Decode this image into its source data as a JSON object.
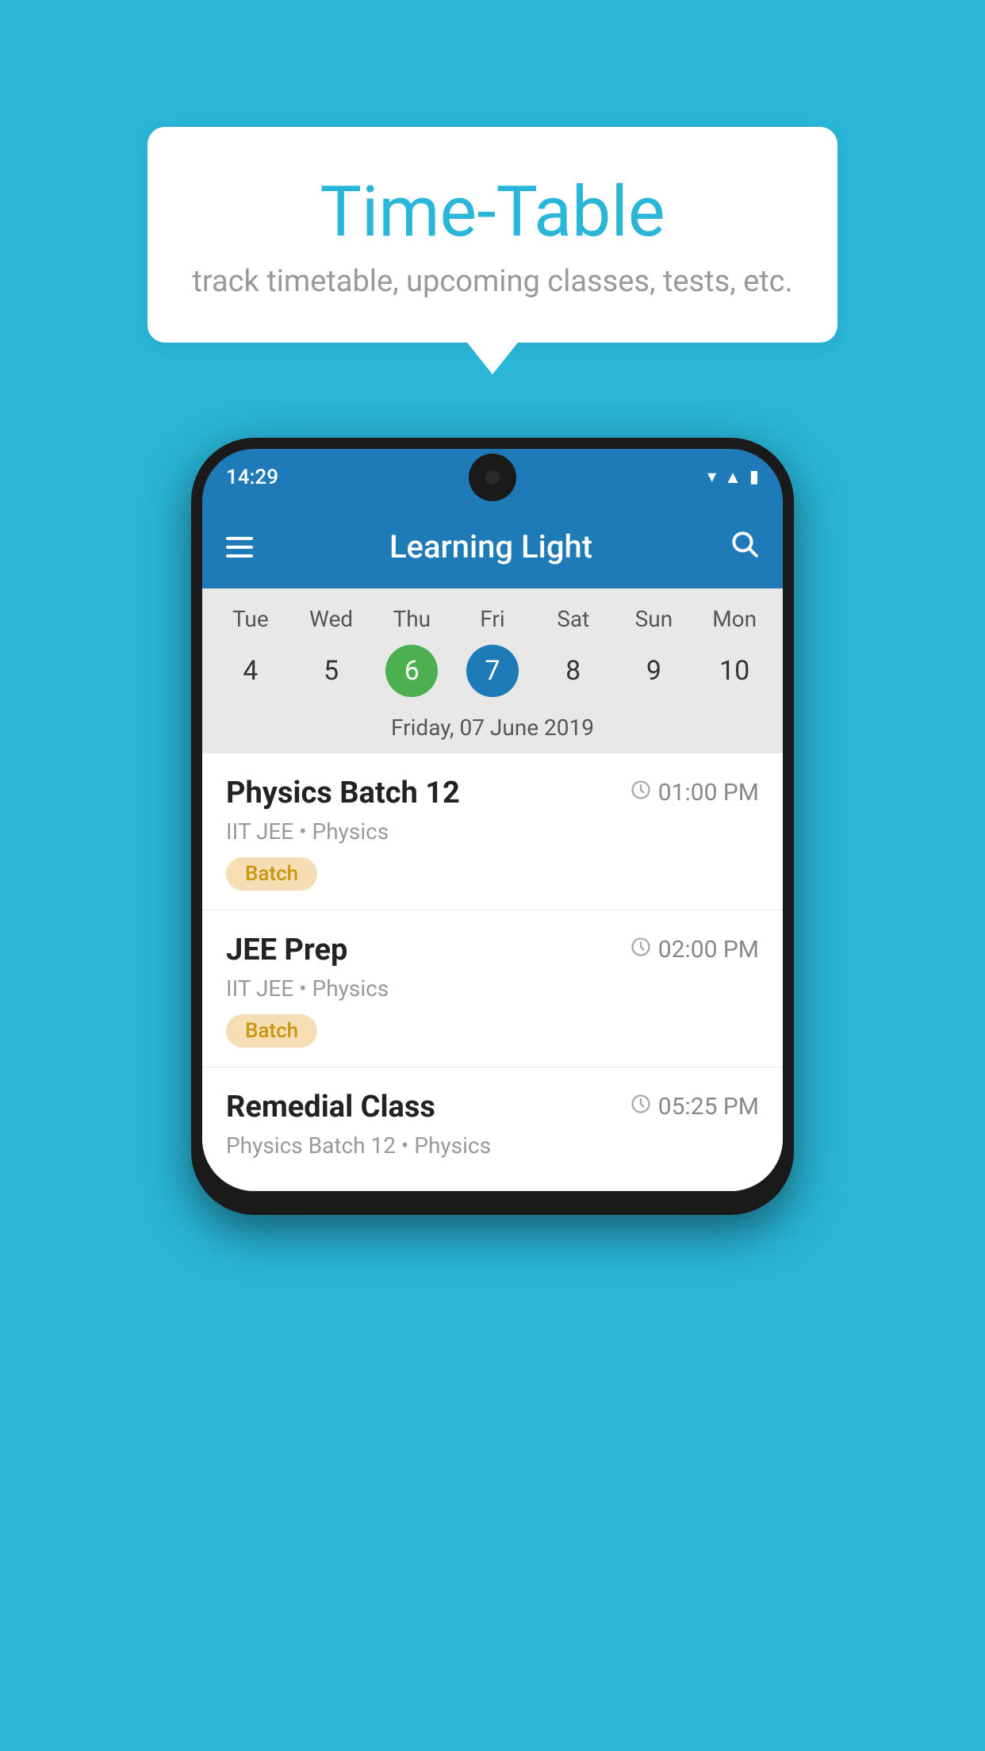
{
  "page": {
    "background_color": "#29B6D8"
  },
  "speech_bubble": {
    "title": "Time-Table",
    "subtitle": "track timetable, upcoming classes, tests, etc."
  },
  "phone": {
    "status_bar": {
      "time": "14:29"
    },
    "app_header": {
      "title": "Learning Light"
    },
    "calendar": {
      "days_of_week": [
        "Tue",
        "Wed",
        "Thu",
        "Fri",
        "Sat",
        "Sun",
        "Mon"
      ],
      "dates": [
        "4",
        "5",
        "6",
        "7",
        "8",
        "9",
        "10"
      ],
      "today_index": 2,
      "selected_index": 3,
      "selected_date_label": "Friday, 07 June 2019"
    },
    "schedule_items": [
      {
        "title": "Physics Batch 12",
        "time": "01:00 PM",
        "subtitle": "IIT JEE • Physics",
        "badge": "Batch"
      },
      {
        "title": "JEE Prep",
        "time": "02:00 PM",
        "subtitle": "IIT JEE • Physics",
        "badge": "Batch"
      },
      {
        "title": "Remedial Class",
        "time": "05:25 PM",
        "subtitle": "Physics Batch 12 • Physics",
        "badge": ""
      }
    ]
  }
}
